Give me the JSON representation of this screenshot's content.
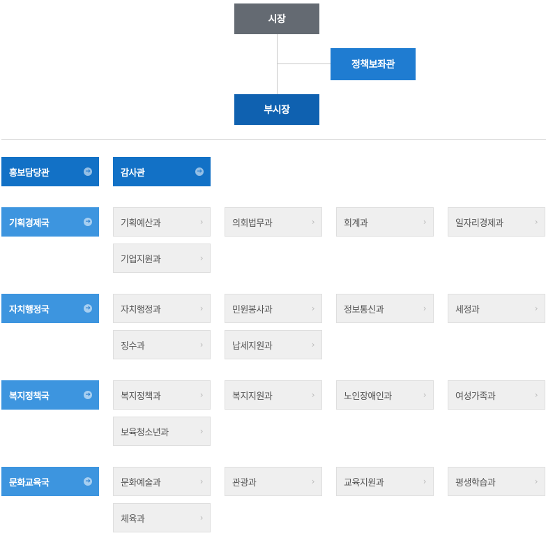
{
  "top": {
    "mayor": "시장",
    "advisor": "정책보좌관",
    "vice_mayor": "부시장"
  },
  "standalone": [
    {
      "label": "홍보담당관",
      "icon": "arrow-right-circle-icon"
    },
    {
      "label": "감사관",
      "icon": "arrow-right-circle-icon"
    }
  ],
  "bureaus": [
    {
      "label": "기획경제국",
      "depts": [
        "기획예산과",
        "의회법무과",
        "회계과",
        "일자리경제과",
        "기업지원과"
      ]
    },
    {
      "label": "자치행정국",
      "depts": [
        "자치행정과",
        "민원봉사과",
        "정보통신과",
        "세정과",
        "징수과",
        "납세지원과"
      ]
    },
    {
      "label": "복지정책국",
      "depts": [
        "복지정책과",
        "복지지원과",
        "노인장애인과",
        "여성가족과",
        "보육청소년과"
      ]
    },
    {
      "label": "문화교육국",
      "depts": [
        "문화예술과",
        "관광과",
        "교육지원과",
        "평생학습과",
        "체육과"
      ]
    }
  ],
  "colors": {
    "mayor": "#646a72",
    "advisor": "#1f7cd1",
    "vice": "#0f61b0",
    "head_dark": "#1271c6",
    "head_light": "#3d95df",
    "dept_bg": "#efefef"
  }
}
